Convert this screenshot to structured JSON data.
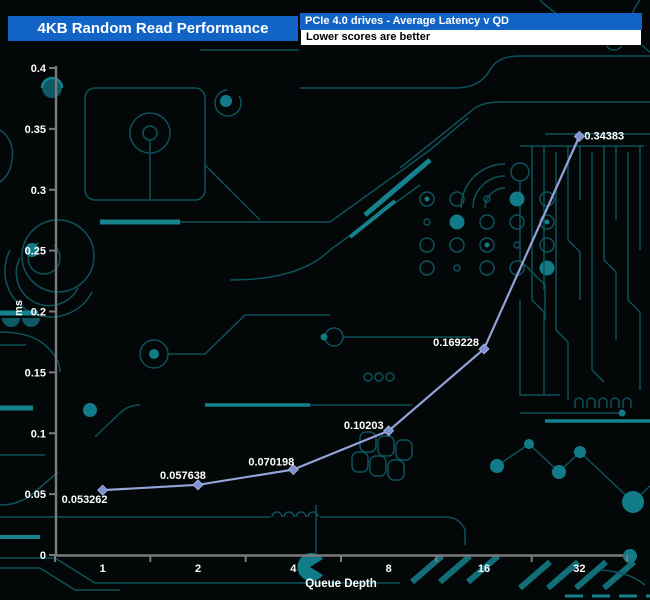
{
  "header": {
    "title": "4KB Random Read Performance",
    "subtitle": "PCIe 4.0 drives - Average Latency v QD",
    "note": "Lower scores are better"
  },
  "chart_data": {
    "type": "line",
    "categories": [
      "1",
      "2",
      "4",
      "8",
      "16",
      "32"
    ],
    "series": [
      {
        "name": "PCIe 4.0 drives - Average Latency",
        "values": [
          0.053262,
          0.057638,
          0.070198,
          0.10203,
          0.169228,
          0.34383
        ]
      }
    ],
    "point_labels": [
      "0.053262",
      "0.057638",
      "0.070198",
      "0.10203",
      "0.169228",
      "0.34383"
    ],
    "title": "4KB Random Read Performance",
    "subtitle": "PCIe 4.0 drives - Average Latency v QD",
    "note": "Lower scores are better",
    "xlabel": "Queue Depth",
    "ylabel": "ms",
    "ylim": [
      0,
      0.4
    ],
    "ytick_step": 0.05,
    "ytick_labels": [
      "0",
      "0.05",
      "0.1",
      "0.15",
      "0.2",
      "0.25",
      "0.3",
      "0.35",
      "0.4"
    ],
    "grid": false,
    "legend": "none"
  },
  "colors": {
    "background": "#030707",
    "header_blue": "#1263c6",
    "note_bg": "#ffffff",
    "trace_teal": "#0d525c",
    "trace_bright": "#15828e",
    "axis_gray": "#7b7b7b",
    "line": "#93a3d9",
    "marker": "#8091d0",
    "label_text": "#ffffff"
  }
}
